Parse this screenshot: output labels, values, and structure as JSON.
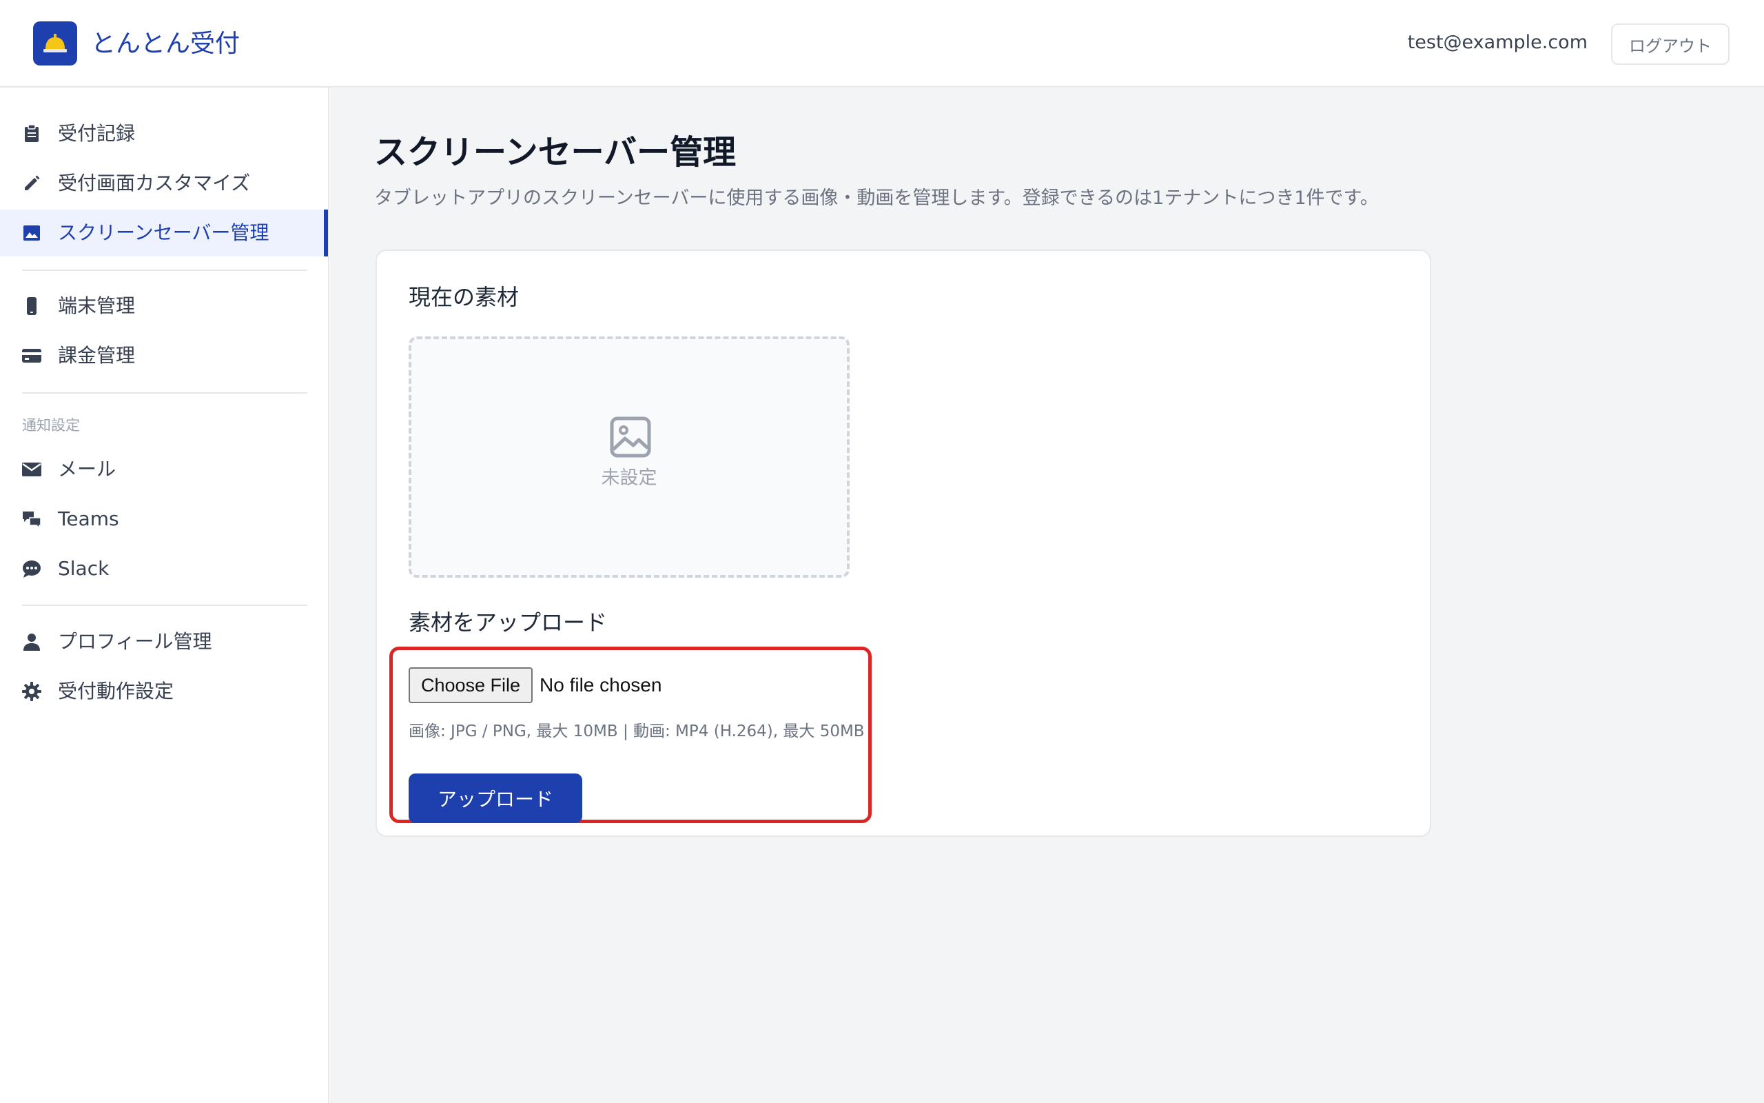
{
  "header": {
    "app_title": "とんとん受付",
    "logo_icon": "bell-icon",
    "user_email": "test@example.com",
    "logout_label": "ログアウト"
  },
  "sidebar": {
    "items": [
      {
        "label": "受付記録",
        "icon": "clipboard-icon"
      },
      {
        "label": "受付画面カスタマイズ",
        "icon": "pencil-icon"
      },
      {
        "label": "スクリーンセーバー管理",
        "icon": "image-icon",
        "active": true
      },
      {
        "label": "端末管理",
        "icon": "phone-icon"
      },
      {
        "label": "課金管理",
        "icon": "credit-card-icon"
      },
      {
        "label": "メール",
        "icon": "mail-icon"
      },
      {
        "label": "Teams",
        "icon": "chat-bubbles-icon"
      },
      {
        "label": "Slack",
        "icon": "chat-icon"
      },
      {
        "label": "プロフィール管理",
        "icon": "person-icon"
      },
      {
        "label": "受付動作設定",
        "icon": "gear-icon"
      }
    ],
    "section_notifications": "通知設定"
  },
  "main": {
    "title": "スクリーンセーバー管理",
    "description": "タブレットアプリのスクリーンセーバーに使用する画像・動画を管理します。登録できるのは1テナントにつき1件です。",
    "current_heading": "現在の素材",
    "preview_empty_label": "未設定",
    "upload_heading": "素材をアップロード",
    "choose_file_label": "Choose File",
    "file_status": "No file chosen",
    "file_hint": "画像: JPG / PNG, 最大 10MB | 動画: MP4 (H.264), 最大 50MB",
    "upload_button": "アップロード"
  },
  "colors": {
    "brand": "#1e3fae",
    "highlight": "#dc2626",
    "background": "#f3f4f6"
  }
}
